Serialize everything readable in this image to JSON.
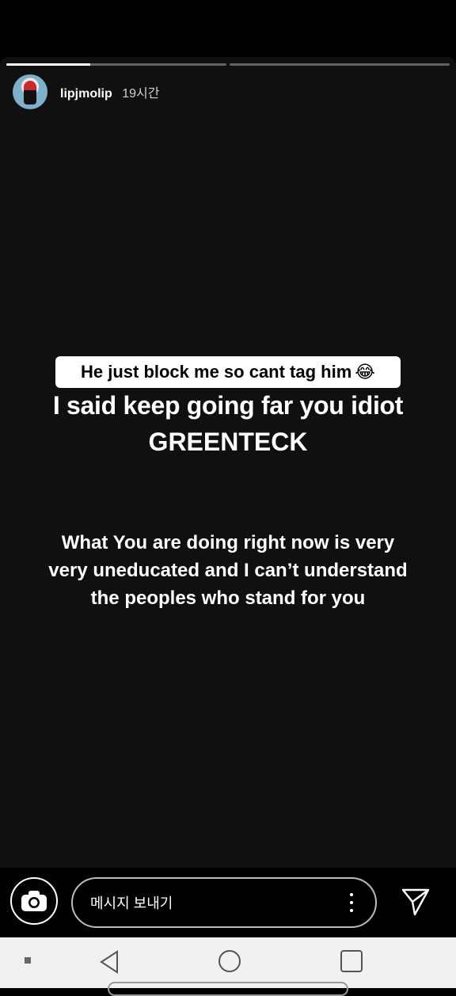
{
  "story": {
    "progress": [
      0.38,
      0.0
    ],
    "user": {
      "username": "lipjmolip",
      "time": "19시간"
    },
    "caption_box": {
      "text": "He just block me so cant tag him",
      "emoji": "😂"
    },
    "line1": "I said keep going far you idiot",
    "line2": "GREENTECK",
    "paragraph": [
      "What You are doing right now is very",
      "very uneducated and I can’t understand",
      "the peoples who stand for you"
    ]
  },
  "bottom_bar": {
    "message_placeholder": "메시지 보내기",
    "icons": {
      "camera": "camera-icon",
      "more": "more-vertical-icon",
      "send": "send-icon"
    }
  },
  "navbar": {
    "icons": [
      "status-square-icon",
      "back-triangle-icon",
      "home-circle-icon",
      "recent-square-icon"
    ]
  }
}
